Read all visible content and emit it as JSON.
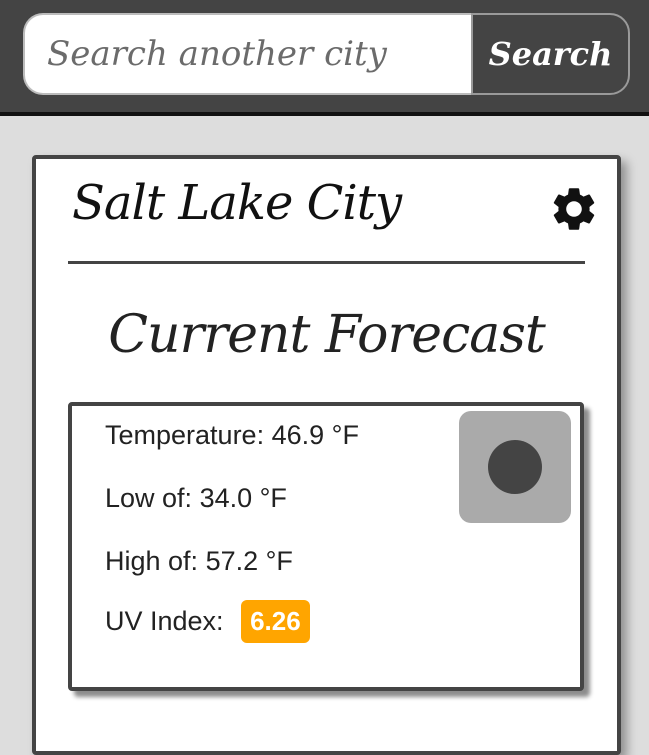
{
  "search": {
    "placeholder": "Search another city",
    "button_label": "Search"
  },
  "city": {
    "name": "Salt Lake City"
  },
  "forecast": {
    "title": "Current Forecast",
    "temperature_label": "Temperature:",
    "temperature_value": "46.9 °F",
    "low_label": "Low of:",
    "low_value": "34.0 °F",
    "high_label": "High of:",
    "high_value": "57.2 °F",
    "uv_label": "UV Index:",
    "uv_value": "6.26",
    "weather_icon": "weather-condition-icon"
  },
  "colors": {
    "topbar": "#444444",
    "uv_badge": "#ffa500",
    "background": "#dddddd"
  }
}
